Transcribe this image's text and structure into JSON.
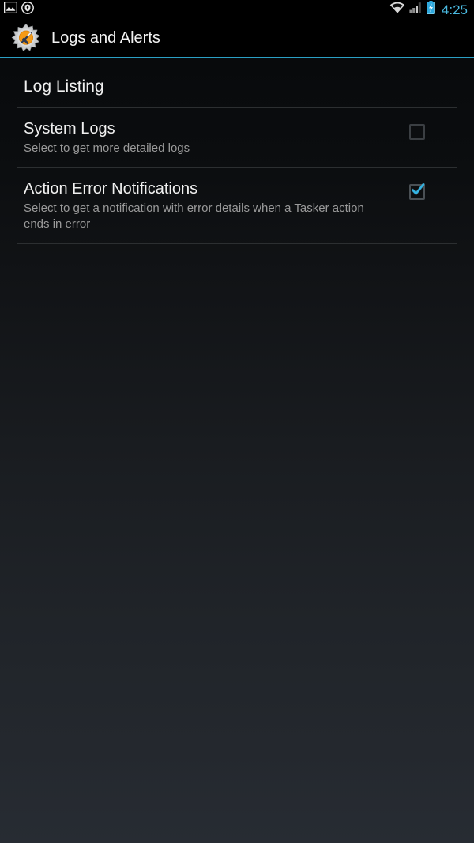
{
  "status_bar": {
    "left_icons": [
      {
        "name": "image-icon",
        "label": "image"
      },
      {
        "name": "shield-badge-icon",
        "label": "shield"
      }
    ],
    "right_icons": [
      {
        "name": "wifi-icon",
        "label": "wifi"
      },
      {
        "name": "cellular-signal-icon",
        "label": "signal"
      },
      {
        "name": "battery-charging-icon",
        "label": "battery charging"
      }
    ],
    "clock": "4:25",
    "clock_color": "#4ab9e0"
  },
  "action_bar": {
    "icon_name": "tasker-gear-icon",
    "title": "Logs and Alerts",
    "underline_color": "#2a9fc4"
  },
  "content": {
    "section": {
      "header": "Log Listing"
    },
    "preferences": [
      {
        "title": "System Logs",
        "summary": "Select to get more detailed logs",
        "checked": false,
        "checkbox_name": "system-logs-checkbox"
      },
      {
        "title": "Action Error Notifications",
        "summary": "Select to get a notification with error details when a Tasker action ends in error",
        "checked": true,
        "checkbox_name": "action-error-notifications-checkbox"
      }
    ],
    "accent_color": "#33b5e5",
    "background_top": "#080a0c",
    "background_bottom": "#272c33"
  }
}
